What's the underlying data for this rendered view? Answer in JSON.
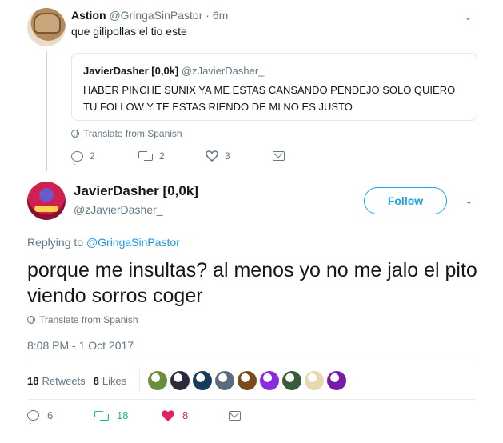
{
  "reply": {
    "display_name": "Astion",
    "handle": "@GringaSinPastor",
    "separator": "·",
    "time": "6m",
    "text": "que gilipollas el tio este",
    "quote": {
      "display_name": "JavierDasher [0,0k]",
      "handle": "@zJavierDasher_",
      "text": "HABER PINCHE SUNIX YA ME ESTAS CANSANDO PENDEJO SOLO QUIERO TU FOLLOW Y TE ESTAS RIENDO DE MI NO ES JUSTO"
    },
    "translate_label": "Translate from Spanish",
    "actions": {
      "replies": "2",
      "retweets": "2",
      "likes": "3"
    }
  },
  "main": {
    "display_name": "JavierDasher [0,0k]",
    "handle": "@zJavierDasher_",
    "follow_label": "Follow",
    "replying_prefix": "Replying to",
    "replying_to": "@GringaSinPastor",
    "text": "porque me insultas? al menos yo no me jalo el pito viendo sorros coger",
    "translate_label": "Translate from Spanish",
    "timestamp": "8:08 PM - 1 Oct 2017",
    "retweets_count": "18",
    "retweets_label": "Retweets",
    "likes_count": "8",
    "likes_label": "Likes",
    "liker_colors": [
      "#6b8e3d",
      "#2a2a3a",
      "#1a3a5a",
      "#5a6a80",
      "#7a4a1a",
      "#8a2be2",
      "#3a5a3a",
      "#e8d8b0",
      "#7a1aa8"
    ],
    "actions": {
      "replies": "6",
      "retweets": "18",
      "likes": "8"
    }
  },
  "colors": {
    "accent": "#1da1f2",
    "retweet_green": "#17bf63",
    "like_red": "#e0245e",
    "muted": "#657786"
  }
}
